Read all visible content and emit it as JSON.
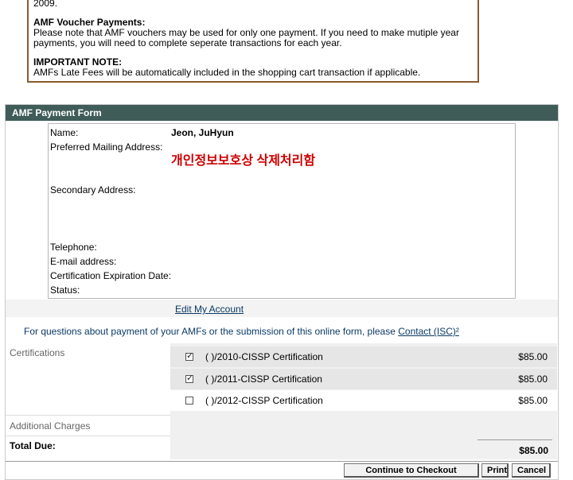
{
  "notice": {
    "top_fragment": "2009.",
    "voucher_title": "AMF Voucher Payments:",
    "voucher_line1": "Please note that AMF vouchers may be used for only one payment. If you need to make mutiple year",
    "voucher_line2": "payments, you will need to complete seperate transactions for each year.",
    "important_title": "IMPORTANT NOTE:",
    "important_text": "AMFs Late Fees will be automatically included in the shopping cart transaction if applicable."
  },
  "form": {
    "header": "AMF Payment Form",
    "labels": {
      "name": "Name:",
      "mailing": "Preferred Mailing Address:",
      "secondary": "Secondary Address:",
      "telephone": "Telephone:",
      "email": "E-mail address:",
      "expiration": "Certification Expiration Date:",
      "status": "Status:"
    },
    "name_value": "Jeon, JuHyun",
    "redaction_note": "개인정보보호상 삭제처리함",
    "edit_account": "Edit My Account",
    "question_text": "For questions about payment of your AMFs or the submission of this online form, please ",
    "contact_link": "Contact (ISC)²"
  },
  "sections": {
    "certifications": "Certifications",
    "additional_charges": "Additional Charges",
    "total_due": "Total Due:"
  },
  "certifications": [
    {
      "name": "(    )/2010-CISSP Certification",
      "price": "$85.00",
      "checked": true
    },
    {
      "name": "(    )/2011-CISSP Certification",
      "price": "$85.00",
      "checked": true
    },
    {
      "name": "(    )/2012-CISSP Certification",
      "price": "$85.00",
      "checked": false
    }
  ],
  "total_value": "$85.00",
  "buttons": {
    "checkout": "Continue to Checkout",
    "print": "Print",
    "cancel": "Cancel"
  }
}
